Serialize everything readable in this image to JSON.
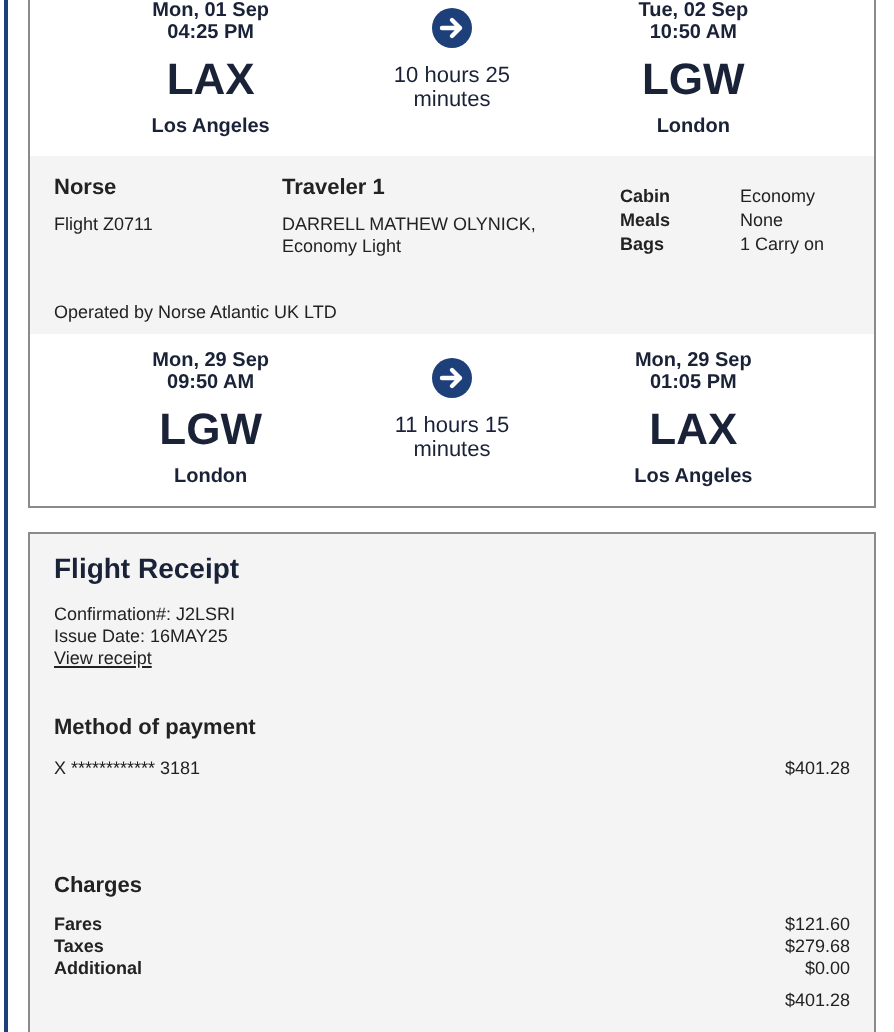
{
  "segments": [
    {
      "depart": {
        "date": "Mon, 01 Sep",
        "time": "04:25 PM",
        "code": "LAX",
        "city": "Los Angeles"
      },
      "duration": "10 hours 25 minutes",
      "arrive": {
        "date": "Tue, 02 Sep",
        "time": "10:50 AM",
        "code": "LGW",
        "city": "London"
      },
      "details": {
        "airline": "Norse",
        "flight": "Flight Z0711",
        "traveler_heading": "Traveler 1",
        "traveler": "DARRELL MATHEW OLYNICK, Economy Light",
        "info": [
          {
            "label": "Cabin",
            "value": "Economy"
          },
          {
            "label": "Meals",
            "value": "None"
          },
          {
            "label": "Bags",
            "value": "1 Carry on"
          }
        ],
        "operated_by": "Operated by Norse Atlantic UK LTD"
      }
    },
    {
      "depart": {
        "date": "Mon, 29 Sep",
        "time": "09:50 AM",
        "code": "LGW",
        "city": "London"
      },
      "duration": "11 hours 15 minutes",
      "arrive": {
        "date": "Mon, 29 Sep",
        "time": "01:05 PM",
        "code": "LAX",
        "city": "Los Angeles"
      }
    }
  ],
  "receipt": {
    "title": "Flight Receipt",
    "confirmation": "Confirmation#: J2LSRI",
    "issue_date": "Issue Date: 16MAY25",
    "link": "View receipt",
    "payment_heading": "Method of payment",
    "payment": {
      "card": "X ************ 3181",
      "amount": "$401.28"
    },
    "charges_heading": "Charges",
    "charges": [
      {
        "label": "Fares",
        "amount": "$121.60"
      },
      {
        "label": "Taxes",
        "amount": "$279.68"
      },
      {
        "label": "Additional",
        "amount": "$0.00"
      }
    ],
    "total": "$401.28"
  }
}
